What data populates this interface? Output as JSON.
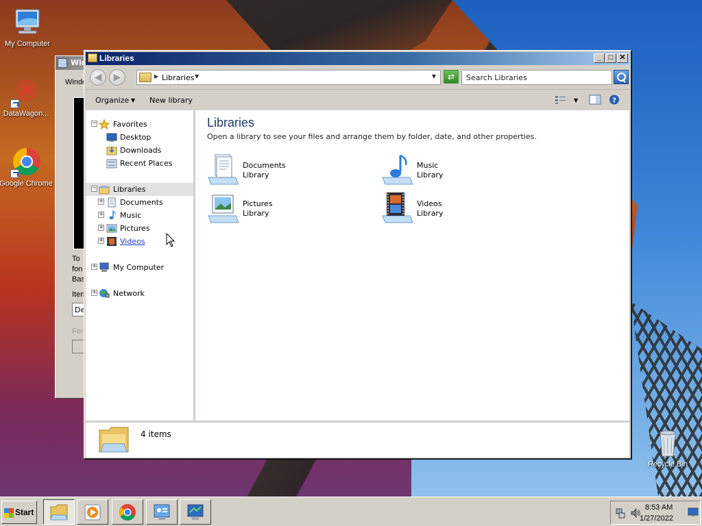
{
  "desktop": {
    "icons": [
      {
        "label": "My Computer",
        "icon": "computer-icon"
      },
      {
        "label": "DataWagon...",
        "icon": "datawagon-icon"
      },
      {
        "label": "Google Chrome",
        "icon": "chrome-icon"
      },
      {
        "label": "Recycle Bin",
        "icon": "recycle-bin-icon"
      }
    ]
  },
  "bg_window": {
    "title": "Wind",
    "menu": "Windo",
    "lines": [
      "To",
      "fon",
      "Bas"
    ],
    "item_label": "Iten",
    "field_value": "De",
    "disabled_label": "For"
  },
  "window": {
    "title": "Libraries",
    "controls": {
      "minimize": "_",
      "maximize": "□",
      "close": "✕"
    },
    "address": {
      "path": "Libraries"
    },
    "search": {
      "placeholder": "Search Libraries"
    },
    "toolbar": {
      "organize": "Organize",
      "new_library": "New library"
    }
  },
  "nav": {
    "favorites": {
      "label": "Favorites",
      "items": [
        "Desktop",
        "Downloads",
        "Recent Places"
      ]
    },
    "libraries": {
      "label": "Libraries",
      "items": [
        "Documents",
        "Music",
        "Pictures",
        "Videos"
      ]
    },
    "my_computer": "My Computer",
    "network": "Network"
  },
  "main": {
    "heading": "Libraries",
    "description": "Open a library to see your files and arrange them by folder, date, and other properties.",
    "libraries": [
      {
        "name": "Documents",
        "sub": "Library",
        "icon": "documents-library-icon"
      },
      {
        "name": "Music",
        "sub": "Library",
        "icon": "music-library-icon"
      },
      {
        "name": "Pictures",
        "sub": "Library",
        "icon": "pictures-library-icon"
      },
      {
        "name": "Videos",
        "sub": "Library",
        "icon": "videos-library-icon"
      }
    ]
  },
  "details": {
    "count": "4 items"
  },
  "taskbar": {
    "start": "Start",
    "clock_time": "8:53 AM",
    "clock_date": "1/27/2022"
  },
  "colors": {
    "title_bar": "#0a246a",
    "heading": "#1e3a6e",
    "link": "#1c3ec8"
  }
}
